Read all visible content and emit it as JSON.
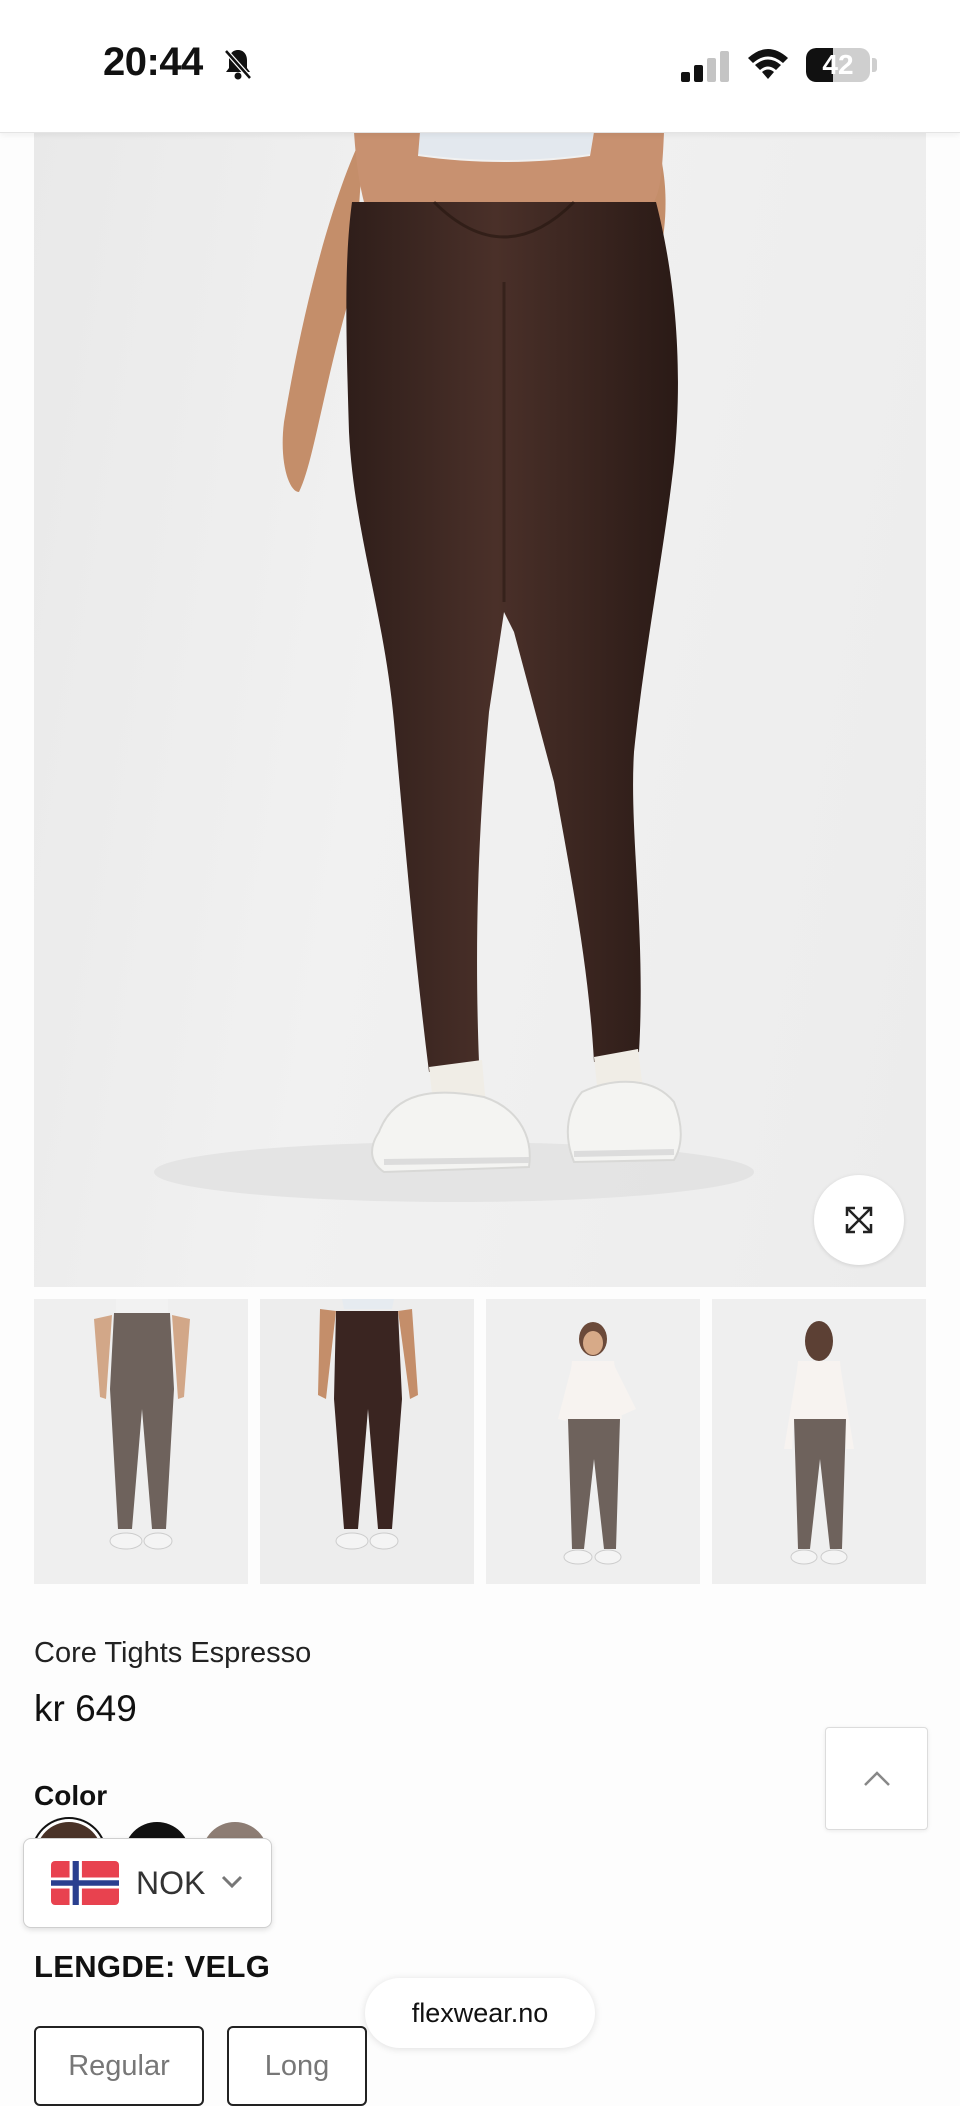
{
  "status_bar": {
    "time": "20:44",
    "battery_level": "42",
    "battery_fraction": 0.42,
    "icons": [
      "bell-slash-icon",
      "cellular-signal-icon",
      "wifi-icon",
      "battery-icon"
    ]
  },
  "gallery": {
    "main_image_alt": "Core Tights Espresso back view",
    "expand_icon": "expand-arrows-icon",
    "thumbnails": [
      "front view grey",
      "back view espresso",
      "front view with top",
      "back view with top"
    ]
  },
  "product": {
    "title": "Core Tights Espresso",
    "price": "kr 649"
  },
  "color": {
    "label": "Color",
    "swatches": [
      "#4a3328",
      "#111111",
      "#8d7d74"
    ],
    "selected": 0
  },
  "currency": {
    "code": "NOK",
    "flag": "norway-flag-icon"
  },
  "length": {
    "label": "LENGDE: VELG",
    "options": [
      "Regular",
      "Long"
    ]
  },
  "browser": {
    "domain": "flexwear.no"
  },
  "colors": {
    "legging": "#3e2823",
    "accent": "#111111",
    "flag_red": "#e8424f",
    "flag_blue": "#2a3f8f"
  }
}
